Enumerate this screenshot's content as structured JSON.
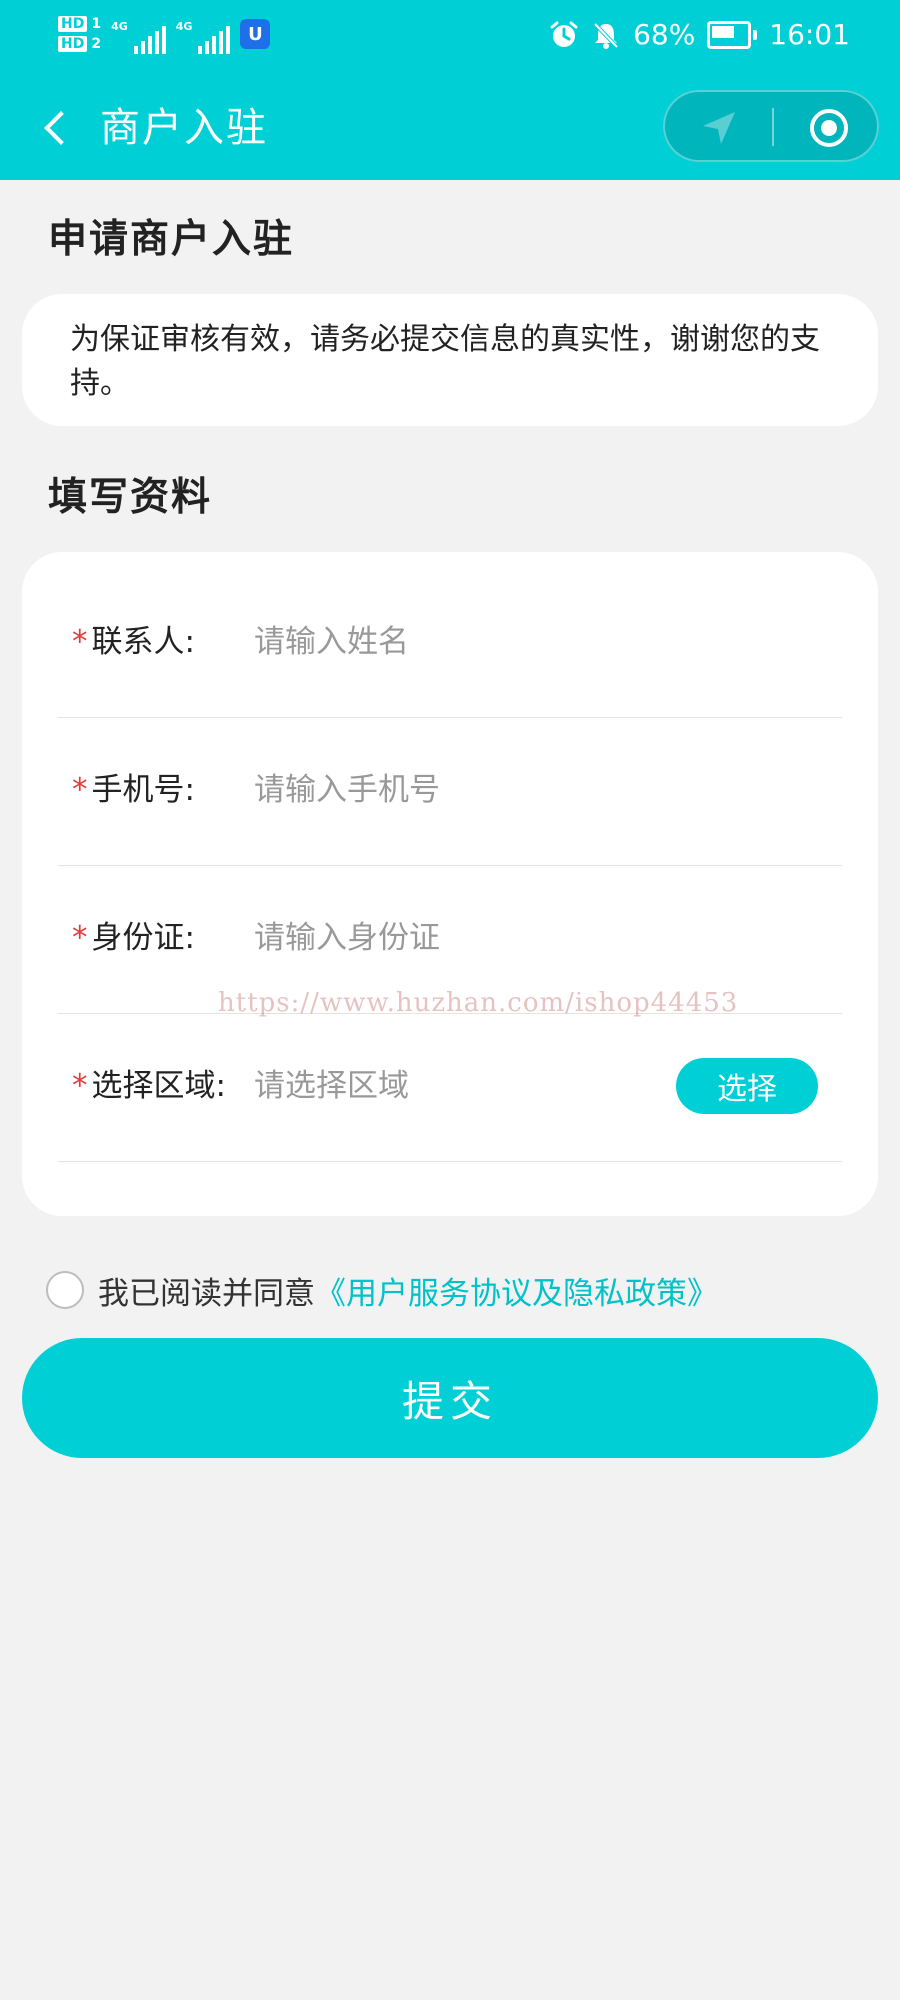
{
  "status_bar": {
    "hd1": "HD",
    "hd1_slot": "1",
    "hd2": "HD",
    "hd2_slot": "2",
    "network1": "4G",
    "network2": "4G",
    "battery": "68%",
    "time": "16:01"
  },
  "nav": {
    "title": "商户入驻"
  },
  "intro": {
    "heading": "申请商户入驻",
    "notice": "为保证审核有效，请务必提交信息的真实性，谢谢您的支持。"
  },
  "form": {
    "heading": "填写资料",
    "required_mark": "*",
    "contact": {
      "label": "联系人:",
      "placeholder": "请输入姓名",
      "value": ""
    },
    "phone": {
      "label": "手机号:",
      "placeholder": "请输入手机号",
      "value": ""
    },
    "id_card": {
      "label": "身份证:",
      "placeholder": "请输入身份证",
      "value": ""
    },
    "region": {
      "label": "选择区域:",
      "value": "请选择区域",
      "button": "选择"
    }
  },
  "agreement": {
    "text": "我已阅读并同意",
    "link": "《用户服务协议及隐私政策》",
    "checked": false
  },
  "submit_label": "提交",
  "watermark": "https://www.huzhan.com/ishop44453",
  "colors": {
    "primary": "#00d0d6",
    "required": "#e23b3b",
    "background": "#f2f2f2"
  }
}
